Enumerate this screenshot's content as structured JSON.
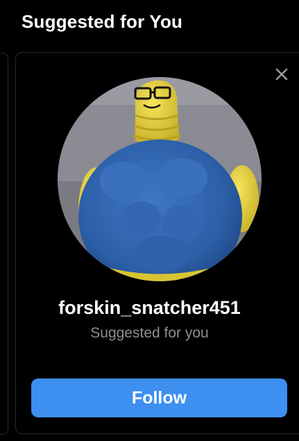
{
  "section": {
    "title": "Suggested for You"
  },
  "card": {
    "username": "forskin_snatcher451",
    "subtitle": "Suggested for you",
    "follow_label": "Follow",
    "close_icon": "close-icon",
    "accent_color": "#3d8ff0"
  }
}
